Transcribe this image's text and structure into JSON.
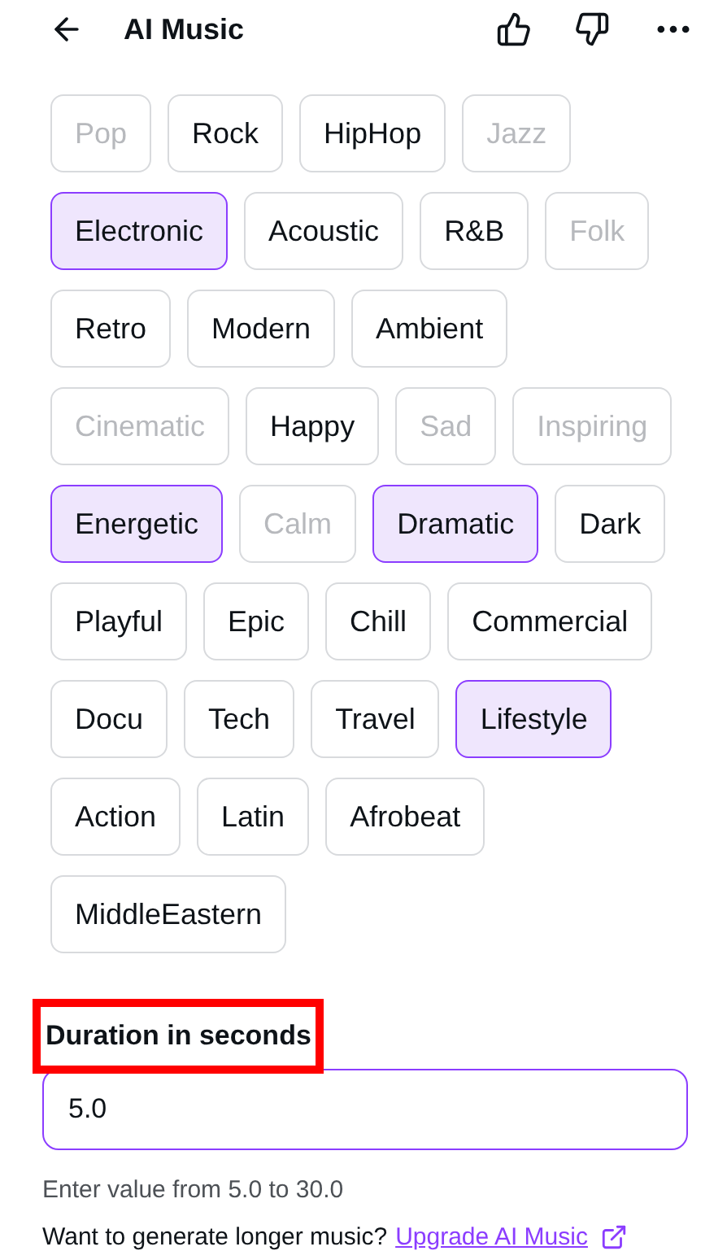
{
  "header": {
    "title": "AI Music"
  },
  "chips": [
    {
      "label": "Pop",
      "selected": false,
      "disabled": true
    },
    {
      "label": "Rock",
      "selected": false,
      "disabled": false
    },
    {
      "label": "HipHop",
      "selected": false,
      "disabled": false
    },
    {
      "label": "Jazz",
      "selected": false,
      "disabled": true
    },
    {
      "label": "Electronic",
      "selected": true,
      "disabled": false
    },
    {
      "label": "Acoustic",
      "selected": false,
      "disabled": false
    },
    {
      "label": "R&B",
      "selected": false,
      "disabled": false
    },
    {
      "label": "Folk",
      "selected": false,
      "disabled": true
    },
    {
      "label": "Retro",
      "selected": false,
      "disabled": false
    },
    {
      "label": "Modern",
      "selected": false,
      "disabled": false
    },
    {
      "label": "Ambient",
      "selected": false,
      "disabled": false
    },
    {
      "label": "Cinematic",
      "selected": false,
      "disabled": true
    },
    {
      "label": "Happy",
      "selected": false,
      "disabled": false
    },
    {
      "label": "Sad",
      "selected": false,
      "disabled": true
    },
    {
      "label": "Inspiring",
      "selected": false,
      "disabled": true
    },
    {
      "label": "Energetic",
      "selected": true,
      "disabled": false
    },
    {
      "label": "Calm",
      "selected": false,
      "disabled": true
    },
    {
      "label": "Dramatic",
      "selected": true,
      "disabled": false
    },
    {
      "label": "Dark",
      "selected": false,
      "disabled": false
    },
    {
      "label": "Playful",
      "selected": false,
      "disabled": false
    },
    {
      "label": "Epic",
      "selected": false,
      "disabled": false
    },
    {
      "label": "Chill",
      "selected": false,
      "disabled": false
    },
    {
      "label": "Commercial",
      "selected": false,
      "disabled": false
    },
    {
      "label": "Docu",
      "selected": false,
      "disabled": false
    },
    {
      "label": "Tech",
      "selected": false,
      "disabled": false
    },
    {
      "label": "Travel",
      "selected": false,
      "disabled": false
    },
    {
      "label": "Lifestyle",
      "selected": true,
      "disabled": false
    },
    {
      "label": "Action",
      "selected": false,
      "disabled": false
    },
    {
      "label": "Latin",
      "selected": false,
      "disabled": false
    },
    {
      "label": "Afrobeat",
      "selected": false,
      "disabled": false
    },
    {
      "label": "MiddleEastern",
      "selected": false,
      "disabled": false
    }
  ],
  "duration": {
    "label": "Duration in seconds",
    "highlighted": true,
    "value": "5.0",
    "hint": "Enter value from 5.0 to 30.0",
    "upsell": "Want to generate longer music?",
    "link": "Upgrade AI Music"
  }
}
